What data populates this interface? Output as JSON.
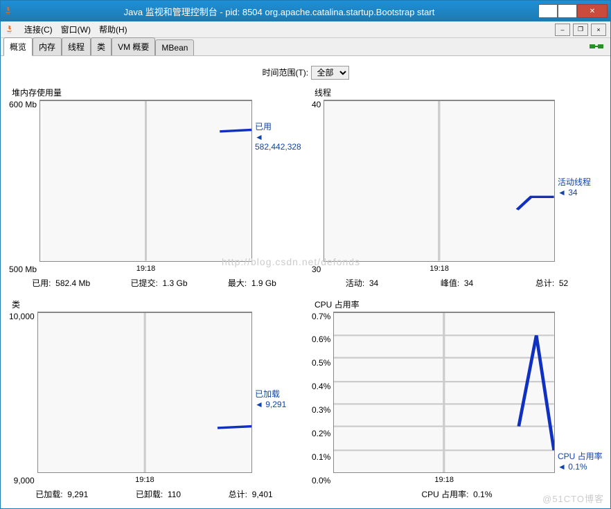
{
  "window": {
    "title": "Java 监视和管理控制台 - pid: 8504 org.apache.catalina.startup.Bootstrap start"
  },
  "menu": {
    "connection": "连接(C)",
    "window": "窗口(W)",
    "help": "帮助(H)"
  },
  "tabs": {
    "overview": "概览",
    "memory": "内存",
    "threads": "线程",
    "classes": "类",
    "vm": "VM 概要",
    "mbean": "MBean"
  },
  "timerange": {
    "label": "时间范围(T):",
    "value": "全部"
  },
  "charts": {
    "heap": {
      "title": "堆内存使用量",
      "ytick_top": "600 Mb",
      "ytick_bot": "500 Mb",
      "xtick": "19:18",
      "legend_label": "已用",
      "legend_value": "582,442,328",
      "stat1_k": "已用:",
      "stat1_v": "582.4 Mb",
      "stat2_k": "已提交:",
      "stat2_v": "1.3 Gb",
      "stat3_k": "最大:",
      "stat3_v": "1.9 Gb"
    },
    "threads": {
      "title": "线程",
      "ytick_top": "40",
      "ytick_bot": "30",
      "xtick": "19:18",
      "legend_label": "活动线程",
      "legend_value": "34",
      "stat1_k": "活动:",
      "stat1_v": "34",
      "stat2_k": "峰值:",
      "stat2_v": "34",
      "stat3_k": "总计:",
      "stat3_v": "52"
    },
    "classes": {
      "title": "类",
      "ytick_top": "10,000",
      "ytick_bot": "9,000",
      "xtick": "19:18",
      "legend_label": "已加载",
      "legend_value": "9,291",
      "stat1_k": "已加载:",
      "stat1_v": "9,291",
      "stat2_k": "已卸载:",
      "stat2_v": "110",
      "stat3_k": "总计:",
      "stat3_v": "9,401"
    },
    "cpu": {
      "title": "CPU 占用率",
      "yticks": [
        "0.7%",
        "0.6%",
        "0.5%",
        "0.4%",
        "0.3%",
        "0.2%",
        "0.1%",
        "0.0%"
      ],
      "xtick": "19:18",
      "legend_label": "CPU 占用率",
      "legend_value": "0.1%",
      "stat_k": "CPU 占用率:",
      "stat_v": "0.1%"
    }
  },
  "watermark1": "http://blog.csdn.net/defonds",
  "watermark2": "@51CTO博客",
  "chart_data": [
    {
      "type": "line",
      "title": "堆内存使用量",
      "ylabel": "Mb",
      "ylim": [
        500,
        600
      ],
      "x": [
        "19:18"
      ],
      "series": [
        {
          "name": "已用",
          "values": [
            582
          ]
        }
      ]
    },
    {
      "type": "line",
      "title": "线程",
      "ylim": [
        30,
        40
      ],
      "x": [
        "19:18"
      ],
      "series": [
        {
          "name": "活动线程",
          "values": [
            34
          ]
        }
      ]
    },
    {
      "type": "line",
      "title": "类",
      "ylim": [
        9000,
        10000
      ],
      "x": [
        "19:18"
      ],
      "series": [
        {
          "name": "已加载",
          "values": [
            9291
          ]
        }
      ]
    },
    {
      "type": "line",
      "title": "CPU 占用率",
      "ylabel": "%",
      "ylim": [
        0.0,
        0.7
      ],
      "x": [
        "19:18"
      ],
      "series": [
        {
          "name": "CPU 占用率",
          "values": [
            0.2,
            0.6,
            0.1
          ]
        }
      ]
    }
  ]
}
